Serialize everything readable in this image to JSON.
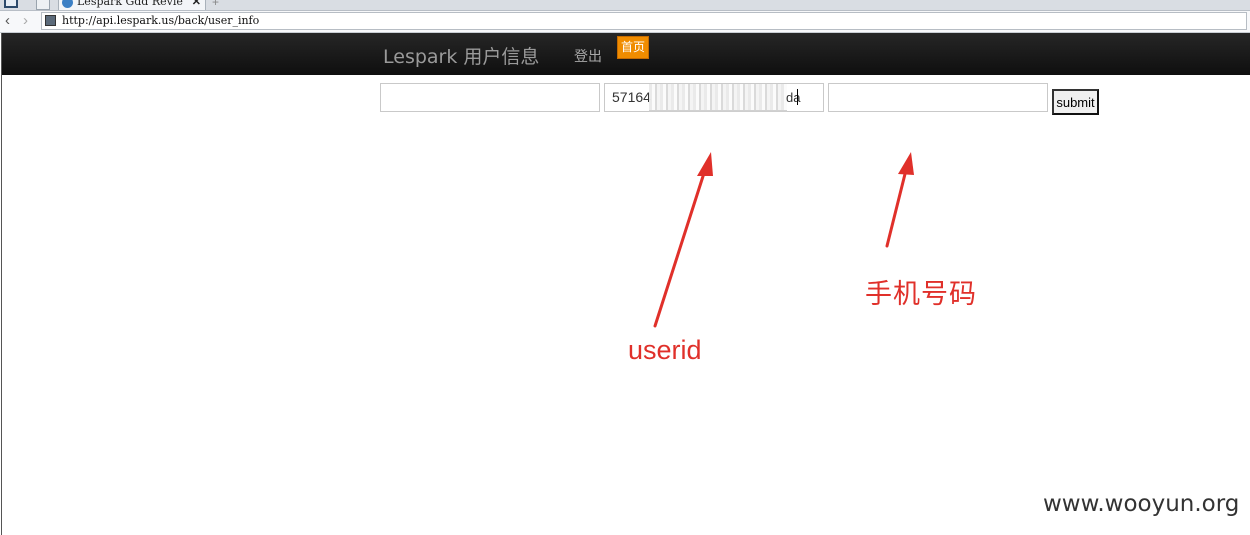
{
  "browser": {
    "tab_title": "Lespark Gdd Revie",
    "tab_close": "✕",
    "new_tab": "+",
    "back_icon": "chevron-left-icon",
    "forward_icon": "chevron-right-icon",
    "back_glyph": "‹",
    "forward_glyph": "›",
    "url": "http://api.lespark.us/back/user_info"
  },
  "navbar": {
    "brand": "Lespark 用户信息",
    "logout_label": "登出",
    "home_label": "首页",
    "home_color": "#f08c00"
  },
  "form": {
    "field1_value": "",
    "field2_value_prefix": "57164",
    "field2_value_suffix": "da",
    "field3_value": "",
    "submit_label": "submit"
  },
  "annotations": {
    "userid_label": "userid",
    "phone_label": "手机号码",
    "color": "#e0302a"
  },
  "watermark": "www.wooyun.org"
}
